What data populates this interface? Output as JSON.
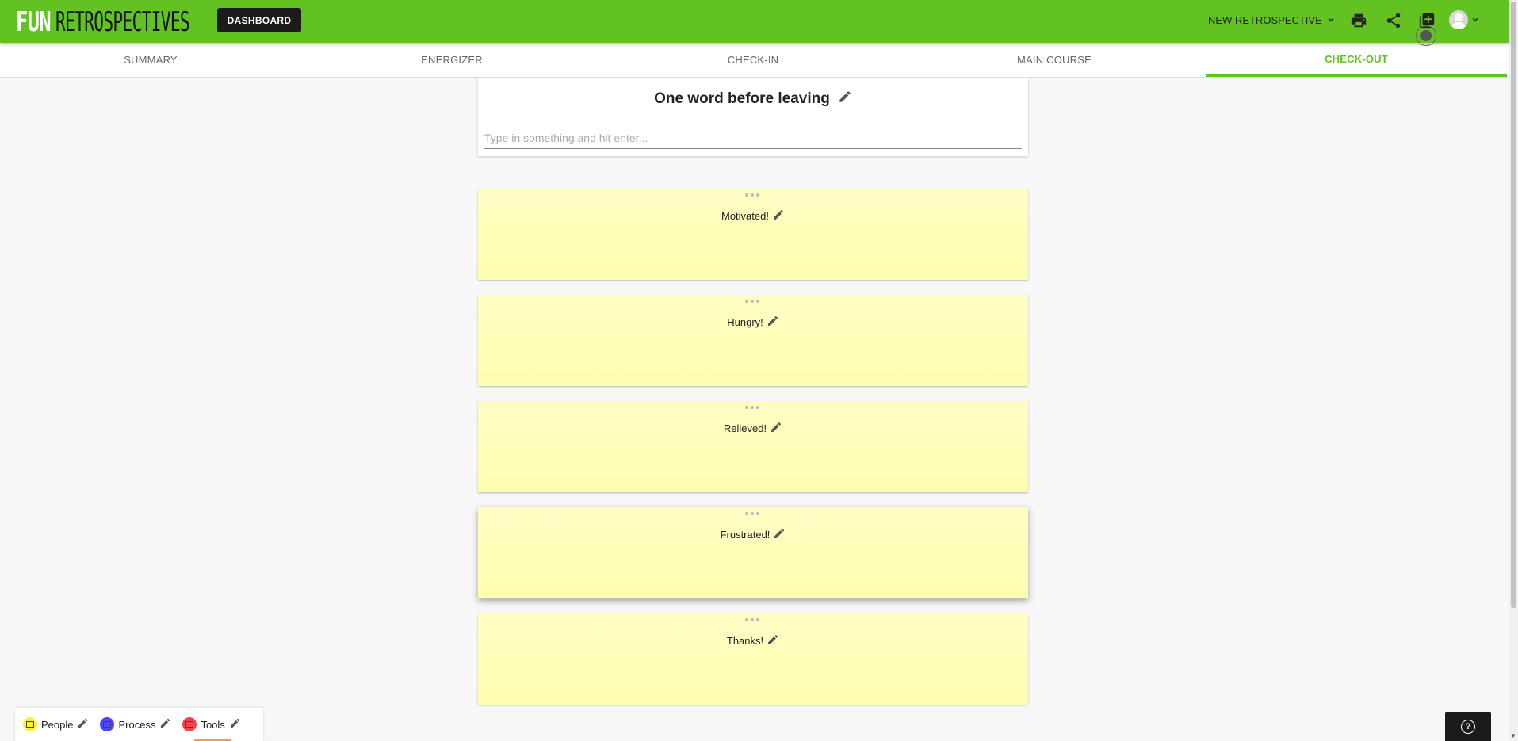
{
  "header": {
    "logo_fun": "FUN",
    "logo_retro": "RETROSPECTIVES",
    "dashboard_label": "DASHBOARD",
    "new_retro_label": "NEW RETROSPECTIVE",
    "accent_color": "#62c221"
  },
  "tabs": [
    {
      "label": "SUMMARY",
      "active": false
    },
    {
      "label": "ENERGIZER",
      "active": false
    },
    {
      "label": "CHECK-IN",
      "active": false
    },
    {
      "label": "MAIN COURSE",
      "active": false
    },
    {
      "label": "CHECK-OUT",
      "active": true
    }
  ],
  "board": {
    "title": "One word before leaving",
    "input_placeholder": "Type in something and hit enter...",
    "input_value": ""
  },
  "notes": [
    {
      "label": "Motivated!"
    },
    {
      "label": "Hungry!"
    },
    {
      "label": "Relieved!"
    },
    {
      "label": "Frustrated!"
    },
    {
      "label": "Thanks!"
    }
  ],
  "legend": [
    {
      "label": "People",
      "color": "#ffef3b"
    },
    {
      "label": "Process",
      "color": "#3b3bff"
    },
    {
      "label": "Tools",
      "color": "#f04040"
    }
  ],
  "icons": {
    "print": "print-icon",
    "share": "share-icon",
    "add": "add-box-icon",
    "account": "account-circle-icon",
    "help": "help-icon"
  }
}
